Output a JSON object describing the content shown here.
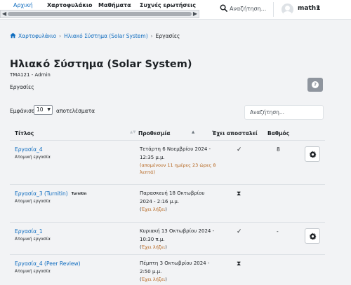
{
  "navbar": {
    "tabs": [
      "Αρχική",
      "Χαρτοφυλάκιο",
      "Μαθήματα",
      "Συχνές ερωτήσεις"
    ],
    "search_label": "Αναζήτηση...",
    "user_name": "math1"
  },
  "breadcrumb": {
    "items": [
      "Χαρτοφυλάκιο",
      "Ηλιακό Σύστημα (Solar System)",
      "Εργασίες"
    ]
  },
  "page": {
    "title": "Ηλιακό Σύστημα (Solar System)",
    "course_meta": "TMA121 - Admin",
    "section": "Εργασίες"
  },
  "controls": {
    "show_label": "Εμφάνισε",
    "length_value": "10",
    "show_suffix": "αποτελέσματα",
    "search_placeholder": "Αναζήτηση..."
  },
  "table": {
    "headers": [
      "Τίτλος",
      "Προθεσμία",
      "Έχει αποσταλεί",
      "Βαθμός"
    ],
    "rows": [
      {
        "name": "Εργασία_4",
        "badge": "",
        "type": "Ατομική εργασία",
        "due": [
          "Τετάρτη 6 Νοεμβρίου 2024 -",
          "12:35 μ.μ."
        ],
        "status": [
          "(απομένουν 11 ημέρες 23 ώρες 8",
          "λεπτά)"
        ],
        "submitted": "✓",
        "grade": "8"
      },
      {
        "name": "Εργασία_3 (Turnitin)",
        "badge": "Turnitin",
        "type": "Ατομική εργασία",
        "due": [
          "Παρασκευή 18 Οκτωβρίου",
          "2024 - 2:16 μ.μ."
        ],
        "status": [
          "Έχει λήξει"
        ],
        "submitted": "⧗",
        "grade": ""
      },
      {
        "name": "Εργασία_1",
        "badge": "",
        "type": "Ατομική εργασία",
        "due": [
          "Κυριακή 13 Οκτωβρίου 2024 -",
          "10:30 π.μ."
        ],
        "status": [
          "Έχει λήξει"
        ],
        "submitted": "✓",
        "grade": "-"
      },
      {
        "name": "Εργασία_4 (Peer Review)",
        "badge": "",
        "type": "Ατομική εργασία",
        "due": [
          "Πέμπτη 3 Οκτωβρίου 2024 -",
          "2:50 μ.μ."
        ],
        "status": [
          "Έχει λήξει"
        ],
        "submitted": "⧗",
        "grade": ""
      }
    ]
  },
  "colors": {
    "link": "#0f6cbf",
    "warning": "#b5651d",
    "help_button": "#8f959e"
  }
}
